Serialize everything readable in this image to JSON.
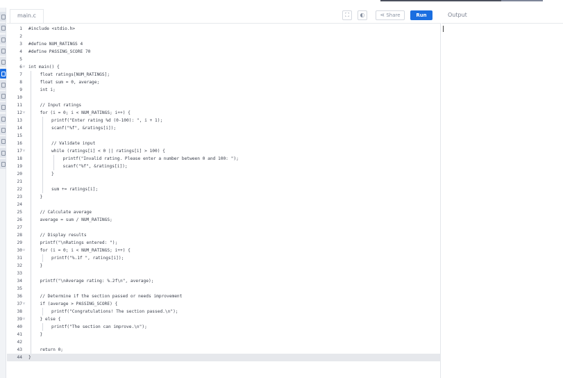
{
  "editor": {
    "file_tab": "main.c",
    "buttons": {
      "fullscreen_icon": "expand-icon",
      "theme_icon": "half-moon-icon",
      "share_label": "Share",
      "run_label": "Run"
    },
    "active_line": 44,
    "lines": [
      {
        "n": "1",
        "fold": "",
        "indent": 0,
        "text": "#include <stdio.h>"
      },
      {
        "n": "2",
        "fold": "",
        "indent": 0,
        "text": ""
      },
      {
        "n": "3",
        "fold": "",
        "indent": 0,
        "text": "#define NUM_RATINGS 4"
      },
      {
        "n": "4",
        "fold": "",
        "indent": 0,
        "text": "#define PASSING_SCORE 70"
      },
      {
        "n": "5",
        "fold": "",
        "indent": 0,
        "text": ""
      },
      {
        "n": "6",
        "fold": "v",
        "indent": 0,
        "text": "int main() {"
      },
      {
        "n": "7",
        "fold": "",
        "indent": 1,
        "text": "float ratings[NUM_RATINGS];"
      },
      {
        "n": "8",
        "fold": "",
        "indent": 1,
        "text": "float sum = 0, average;"
      },
      {
        "n": "9",
        "fold": "",
        "indent": 1,
        "text": "int i;"
      },
      {
        "n": "10",
        "fold": "",
        "indent": 1,
        "text": ""
      },
      {
        "n": "11",
        "fold": "",
        "indent": 1,
        "text": "// Input ratings"
      },
      {
        "n": "12",
        "fold": "v",
        "indent": 1,
        "text": "for (i = 0; i < NUM_RATINGS; i++) {"
      },
      {
        "n": "13",
        "fold": "",
        "indent": 2,
        "text": "printf(\"Enter rating %d (0-100): \", i + 1);"
      },
      {
        "n": "14",
        "fold": "",
        "indent": 2,
        "text": "scanf(\"%f\", &ratings[i]);"
      },
      {
        "n": "15",
        "fold": "",
        "indent": 2,
        "text": ""
      },
      {
        "n": "16",
        "fold": "",
        "indent": 2,
        "text": "// Validate input"
      },
      {
        "n": "17",
        "fold": "v",
        "indent": 2,
        "text": "while (ratings[i] < 0 || ratings[i] > 100) {"
      },
      {
        "n": "18",
        "fold": "",
        "indent": 3,
        "text": "printf(\"Invalid rating. Please enter a number between 0 and 100: \");"
      },
      {
        "n": "19",
        "fold": "",
        "indent": 3,
        "text": "scanf(\"%f\", &ratings[i]);"
      },
      {
        "n": "20",
        "fold": "",
        "indent": 2,
        "text": "}"
      },
      {
        "n": "21",
        "fold": "",
        "indent": 2,
        "text": ""
      },
      {
        "n": "22",
        "fold": "",
        "indent": 2,
        "text": "sum += ratings[i];"
      },
      {
        "n": "23",
        "fold": "",
        "indent": 1,
        "text": "}"
      },
      {
        "n": "24",
        "fold": "",
        "indent": 1,
        "text": ""
      },
      {
        "n": "25",
        "fold": "",
        "indent": 1,
        "text": "// Calculate average"
      },
      {
        "n": "26",
        "fold": "",
        "indent": 1,
        "text": "average = sum / NUM_RATINGS;"
      },
      {
        "n": "27",
        "fold": "",
        "indent": 1,
        "text": ""
      },
      {
        "n": "28",
        "fold": "",
        "indent": 1,
        "text": "// Display results"
      },
      {
        "n": "29",
        "fold": "",
        "indent": 1,
        "text": "printf(\"\\nRatings entered: \");"
      },
      {
        "n": "30",
        "fold": "v",
        "indent": 1,
        "text": "for (i = 0; i < NUM_RATINGS; i++) {"
      },
      {
        "n": "31",
        "fold": "",
        "indent": 2,
        "text": "printf(\"%.1f \", ratings[i]);"
      },
      {
        "n": "32",
        "fold": "",
        "indent": 1,
        "text": "}"
      },
      {
        "n": "33",
        "fold": "",
        "indent": 1,
        "text": ""
      },
      {
        "n": "34",
        "fold": "",
        "indent": 1,
        "text": "printf(\"\\nAverage rating: %.2f\\n\", average);"
      },
      {
        "n": "35",
        "fold": "",
        "indent": 1,
        "text": ""
      },
      {
        "n": "36",
        "fold": "",
        "indent": 1,
        "text": "// Determine if the section passed or needs improvement"
      },
      {
        "n": "37",
        "fold": "v",
        "indent": 1,
        "text": "if (average > PASSING_SCORE) {"
      },
      {
        "n": "38",
        "fold": "",
        "indent": 2,
        "text": "printf(\"Congratulations! The section passed.\\n\");"
      },
      {
        "n": "39",
        "fold": "v",
        "indent": 1,
        "text": "} else {"
      },
      {
        "n": "40",
        "fold": "",
        "indent": 2,
        "text": "printf(\"The section can improve.\\n\");"
      },
      {
        "n": "41",
        "fold": "",
        "indent": 1,
        "text": "}"
      },
      {
        "n": "42",
        "fold": "",
        "indent": 1,
        "text": ""
      },
      {
        "n": "43",
        "fold": "",
        "indent": 1,
        "text": "return 0;"
      },
      {
        "n": "44",
        "fold": "",
        "indent": 0,
        "text": "}"
      }
    ]
  },
  "output": {
    "title": "Output"
  },
  "left_rail": {
    "icons": [
      "file-icon",
      "git-icon",
      "terminal-icon",
      "book-icon",
      "chart-icon",
      "c-language-icon",
      "settings-icon",
      "gear-icon",
      "code-icon",
      "link-icon",
      "box-icon",
      "globe-icon",
      "warning-icon",
      "bug-icon"
    ],
    "active_index": 5,
    "accent": "#1e6fe3"
  },
  "colors": {
    "run_button": "#1a6ee0",
    "active_line_bg": "#e6e8ec"
  }
}
